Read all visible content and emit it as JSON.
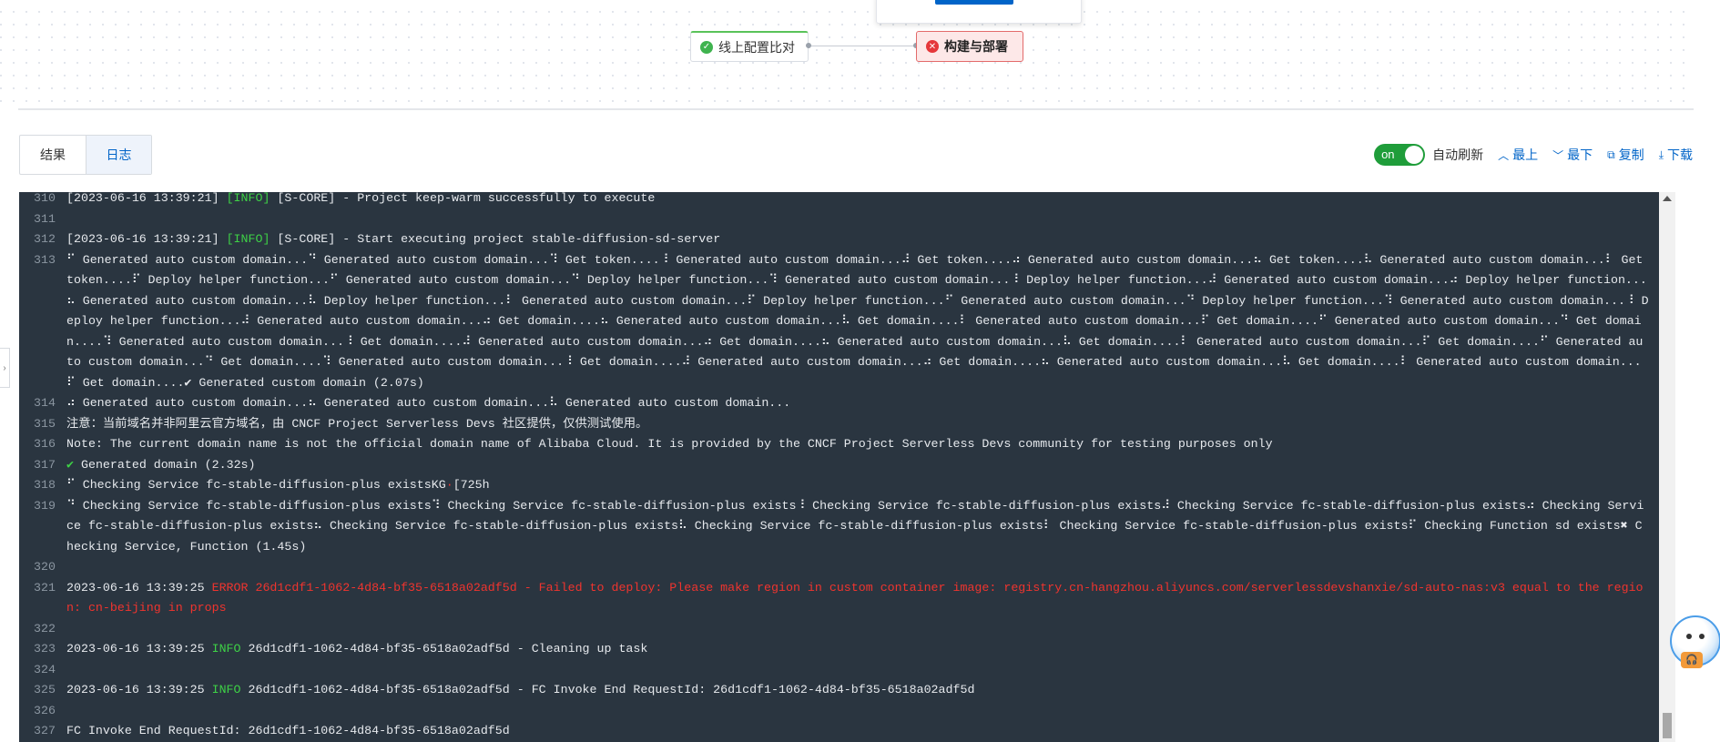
{
  "pipeline": {
    "stage1": {
      "label": "线上配置比对",
      "status": "success"
    },
    "stage2": {
      "label": "构建与部署",
      "status": "failed"
    }
  },
  "tabs": [
    {
      "label": "结果",
      "active": false
    },
    {
      "label": "日志",
      "active": true
    }
  ],
  "toolbar": {
    "toggle_state": "on",
    "auto_refresh": "自动刷新",
    "top": "最上",
    "bottom": "最下",
    "copy": "复制",
    "download": "下载"
  },
  "console": {
    "lines": [
      {
        "n": "310",
        "parts": [
          {
            "t": "[2023-06-16 13:39:21] "
          },
          {
            "t": "[INFO]",
            "c": "info"
          },
          {
            "t": " [S-CORE] - Project keep-warm successfully to execute"
          }
        ]
      },
      {
        "n": "311",
        "parts": [
          {
            "t": ""
          }
        ]
      },
      {
        "n": "312",
        "parts": [
          {
            "t": "[2023-06-16 13:39:21] "
          },
          {
            "t": "[INFO]",
            "c": "info"
          },
          {
            "t": " [S-CORE] - Start executing project stable-diffusion-sd-server"
          }
        ]
      },
      {
        "n": "313",
        "parts": [
          {
            "t": "⠋ Generated auto custom domain...⠙ Generated auto custom domain...⠹ Get token....⠸ Generated auto custom domain...⠼ Get token....⠴ Generated auto custom domain...⠦ Get token....⠧ Generated auto custom domain...⠇ Get token....⠏ Deploy helper function...⠋ Generated auto custom domain...⠙ Deploy helper function...⠹ Generated auto custom domain...⠸ Deploy helper function...⠼ Generated auto custom domain...⠴ Deploy helper function...⠦ Generated auto custom domain...⠧ Deploy helper function...⠇ Generated auto custom domain...⠏ Deploy helper function...⠋ Generated auto custom domain...⠙ Deploy helper function...⠹ Generated auto custom domain...⠸ Deploy helper function...⠼ Generated auto custom domain...⠴ Get domain....⠦ Generated auto custom domain...⠧ Get domain....⠇ Generated auto custom domain...⠏ Get domain....⠋ Generated auto custom domain...⠙ Get domain....⠹ Generated auto custom domain...⠸ Get domain....⠼ Generated auto custom domain...⠴ Get domain....⠦ Generated auto custom domain...⠧ Get domain....⠇ Generated auto custom domain...⠏ Get domain....⠋ Generated auto custom domain...⠙ Get domain....⠹ Generated auto custom domain...⠸ Get domain....⠼ Generated auto custom domain...⠴ Get domain....⠦ Generated auto custom domain...⠧ Get domain....⠇ Generated auto custom domain...⠏ Get domain....✔ Generated custom domain (2.07s)"
          }
        ]
      },
      {
        "n": "314",
        "parts": [
          {
            "t": "⠴ Generated auto custom domain...⠦ Generated auto custom domain...⠧ Generated auto custom domain..."
          }
        ]
      },
      {
        "n": "315",
        "parts": [
          {
            "t": "注意：当前域名并非阿里云官方域名，由 CNCF Project Serverless Devs 社区提供，仅供测试使用。"
          }
        ]
      },
      {
        "n": "316",
        "parts": [
          {
            "t": "Note: The current domain name is not the official domain name of Alibaba Cloud. It is provided by the CNCF Project Serverless Devs community for testing purposes only"
          }
        ]
      },
      {
        "n": "317",
        "parts": [
          {
            "t": "✔",
            "c": "info"
          },
          {
            "t": " Generated domain (2.32s)"
          }
        ]
      },
      {
        "n": "318",
        "parts": [
          {
            "t": "⠋ Checking Service fc-stable-diffusion-plus existsKG"
          },
          {
            "t": "·",
            "c": "err"
          },
          {
            "t": "[725h"
          }
        ]
      },
      {
        "n": "319",
        "parts": [
          {
            "t": "⠙ Checking Service fc-stable-diffusion-plus exists⠹ Checking Service fc-stable-diffusion-plus exists⠸ Checking Service fc-stable-diffusion-plus exists⠼ Checking Service fc-stable-diffusion-plus exists⠴ Checking Service fc-stable-diffusion-plus exists⠦ Checking Service fc-stable-diffusion-plus exists⠧ Checking Service fc-stable-diffusion-plus exists⠇ Checking Service fc-stable-diffusion-plus exists⠏ Checking Function sd exists✖ Checking Service, Function (1.45s)"
          }
        ]
      },
      {
        "n": "320",
        "parts": [
          {
            "t": ""
          }
        ]
      },
      {
        "n": "321",
        "parts": [
          {
            "t": "2023-06-16 13:39:25 "
          },
          {
            "t": "ERROR 26d1cdf1-1062-4d84-bf35-6518a02adf5d - Failed to deploy: Please make region in custom container image: registry.cn-hangzhou.aliyuncs.com/serverlessdevshanxie/sd-auto-nas:v3 equal to the region: cn-beijing in props",
            "c": "err"
          }
        ]
      },
      {
        "n": "322",
        "parts": [
          {
            "t": ""
          }
        ]
      },
      {
        "n": "323",
        "parts": [
          {
            "t": "2023-06-16 13:39:25 "
          },
          {
            "t": "INFO",
            "c": "info"
          },
          {
            "t": " 26d1cdf1-1062-4d84-bf35-6518a02adf5d - Cleaning up task"
          }
        ]
      },
      {
        "n": "324",
        "parts": [
          {
            "t": ""
          }
        ]
      },
      {
        "n": "325",
        "parts": [
          {
            "t": "2023-06-16 13:39:25 "
          },
          {
            "t": "INFO",
            "c": "info"
          },
          {
            "t": " 26d1cdf1-1062-4d84-bf35-6518a02adf5d - FC Invoke End RequestId: 26d1cdf1-1062-4d84-bf35-6518a02adf5d"
          }
        ]
      },
      {
        "n": "326",
        "parts": [
          {
            "t": ""
          }
        ]
      },
      {
        "n": "327",
        "parts": [
          {
            "t": "FC Invoke End RequestId: 26d1cdf1-1062-4d84-bf35-6518a02adf5d"
          }
        ]
      }
    ]
  },
  "colors": {
    "accent": "#0064c8",
    "console_bg": "#2a3540",
    "info": "#3ed146",
    "error": "#f0342e",
    "toggle_on": "#1f9d3a"
  }
}
